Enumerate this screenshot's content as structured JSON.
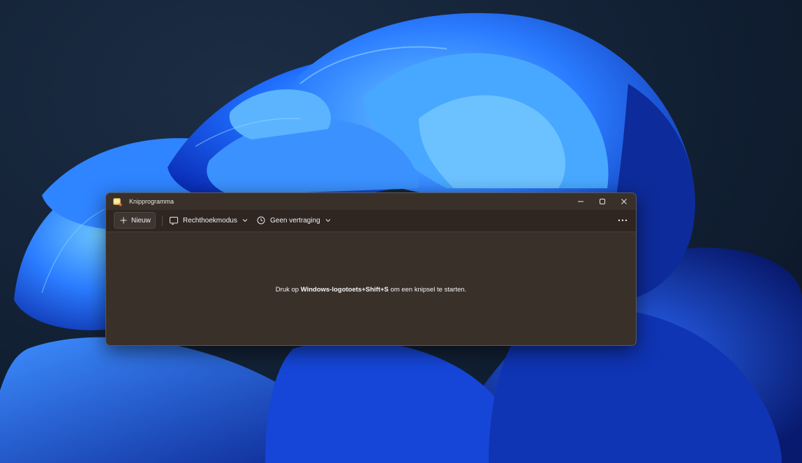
{
  "window": {
    "title": "Knipprogramma",
    "app_icon": "snipping-tool-icon",
    "controls": {
      "minimize_icon": "minimize-icon",
      "maximize_icon": "maximize-icon",
      "close_icon": "close-icon"
    }
  },
  "toolbar": {
    "new_label": "Nieuw",
    "new_icon": "plus-icon",
    "mode": {
      "label": "Rechthoekmodus",
      "icon": "rectangle-mode-icon"
    },
    "delay": {
      "label": "Geen vertraging",
      "icon": "clock-icon"
    },
    "more_icon": "more-options-icon"
  },
  "content": {
    "hint_prefix": "Druk op ",
    "hint_shortcut": "Windows-logotoets+Shift+S",
    "hint_suffix": " om een knipsel te starten."
  },
  "colors": {
    "window_bg": "#3a302a",
    "toolbar_bg": "#2f2621",
    "wallpaper_blue": "#1a5cff",
    "desktop_bg": "#122034"
  }
}
